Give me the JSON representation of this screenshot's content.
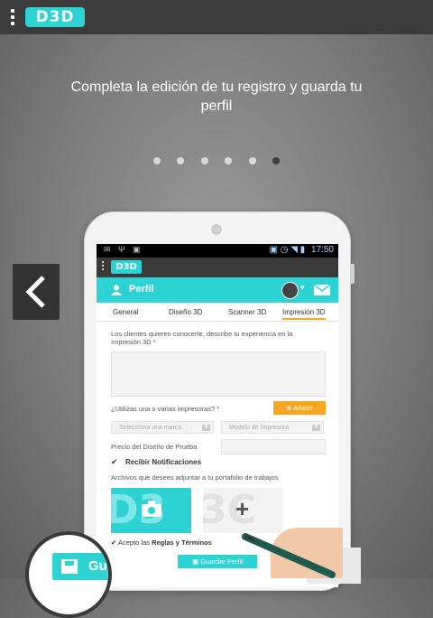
{
  "topbar": {
    "logo": "D3D"
  },
  "headline": "Completa la edición de tu registro y guarda tu perfil",
  "pager": {
    "count": 6,
    "active_index": 5
  },
  "phone": {
    "status_time": "17:50",
    "app_logo": "D3D",
    "profile_title": "Perfil",
    "tabs": [
      "General",
      "Diseño 3D",
      "Scanner 3D",
      "Impresión 3D"
    ],
    "active_tab": "Impresión 3D",
    "form": {
      "experience_label": "Los clientes quieren conocerte, describe tu experiencia en la Impresión 3D *",
      "printers_label": "¿Utilizas una o varias impresoras? *",
      "add_button": "Añadir",
      "brand_placeholder": "Selecciona una marca",
      "model_placeholder": "Modelo de Impresora",
      "price_label": "Precio del Diseño de Prueba",
      "notifications_label": "Recibir Notificaciones",
      "files_label": "Archivos que desees adjuntar a tu portafolio de trabajos",
      "accept_prefix": "Acepto las",
      "accept_rules": "Reglas y Términos",
      "save_button": "Guardar Perfil"
    }
  },
  "zoom_save_button": "Gu",
  "colors": {
    "accent": "#2dd3d3",
    "orange": "#f5a623",
    "dark": "#3b3b3b"
  }
}
